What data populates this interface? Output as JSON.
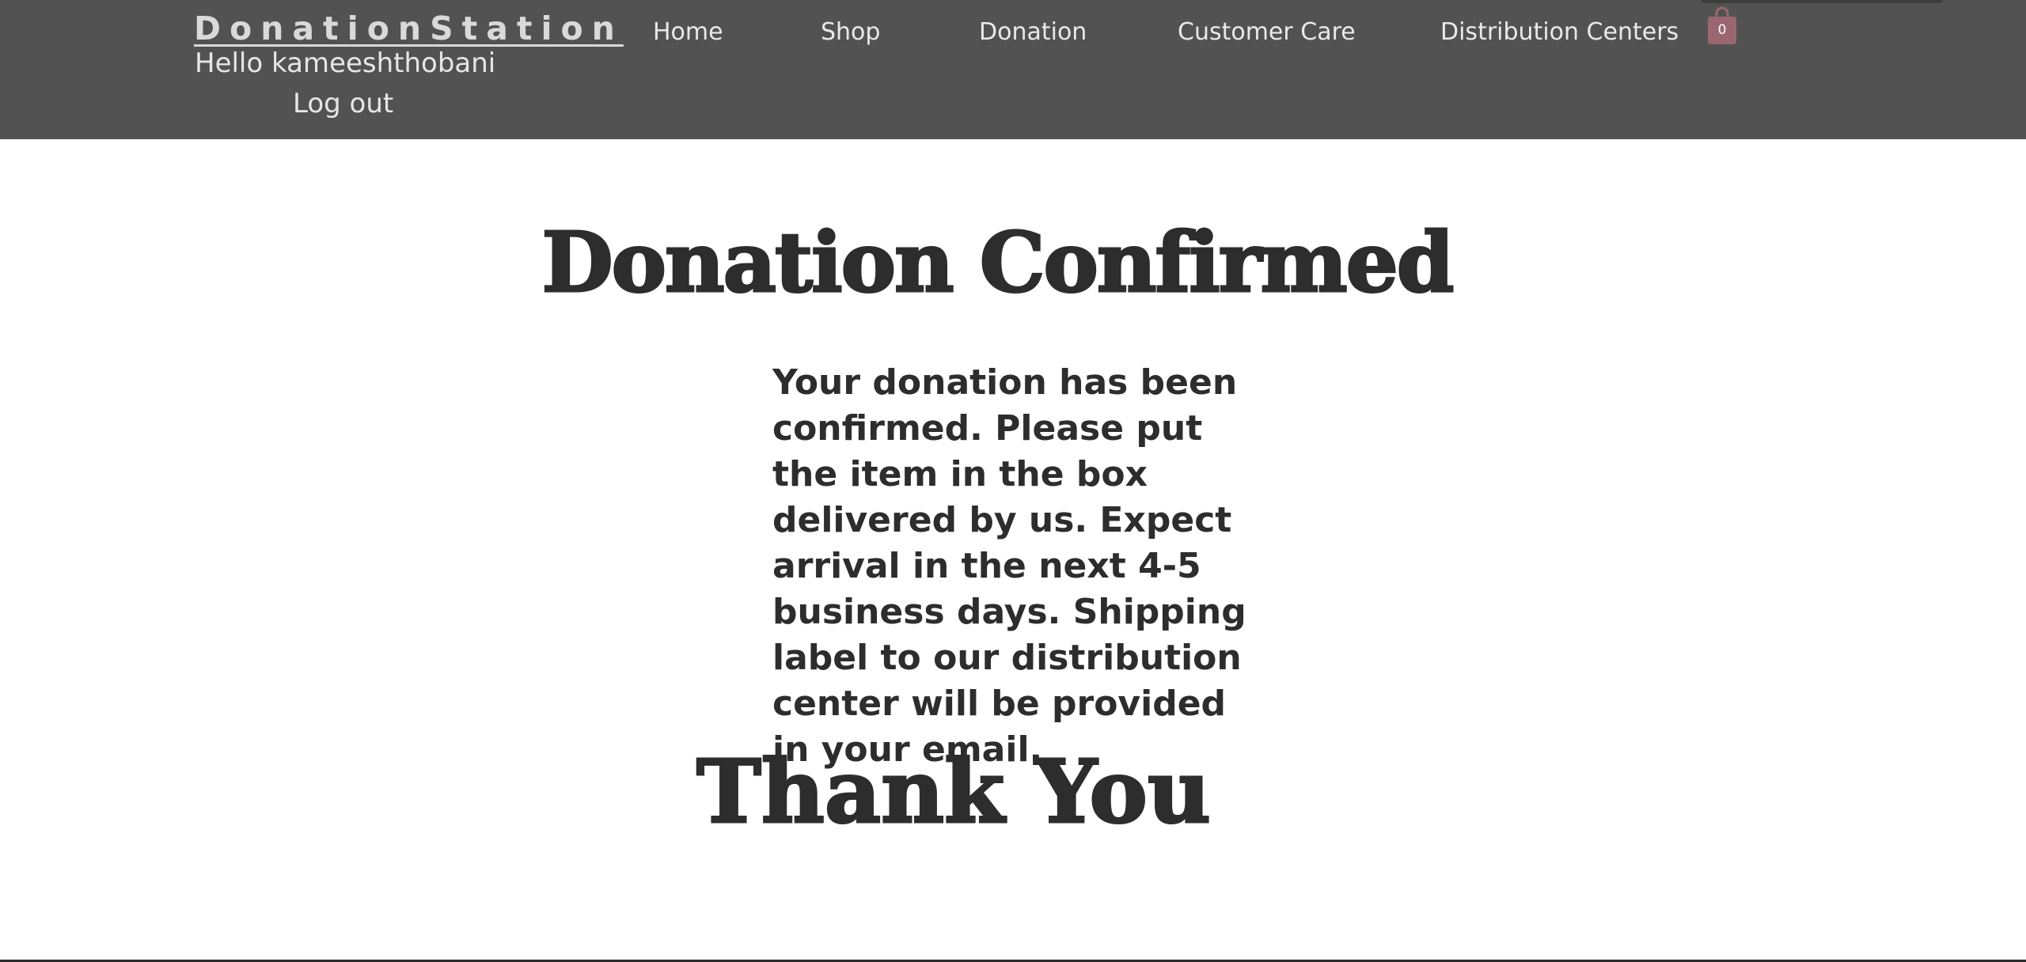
{
  "header": {
    "brand": "DonationStation",
    "greeting": "Hello kameeshthobani",
    "logout_label": "Log out",
    "nav": {
      "home": "Home",
      "shop": "Shop",
      "donation": "Donation",
      "customer_care": "Customer Care",
      "distribution_centers": "Distribution Centers"
    },
    "cart": {
      "icon": "shopping-bag-icon",
      "count": "0",
      "color": "#9a6670"
    },
    "background_color": "#525252"
  },
  "main": {
    "title": "Donation Confirmed",
    "message": "Your donation has been confirmed. Please put the item in the box delivered by us. Expect arrival in the next 4-5 business days. Shipping label to our distribution center will be provided in your email.",
    "thanks": "Thank You",
    "text_color": "#2d2d2d"
  }
}
